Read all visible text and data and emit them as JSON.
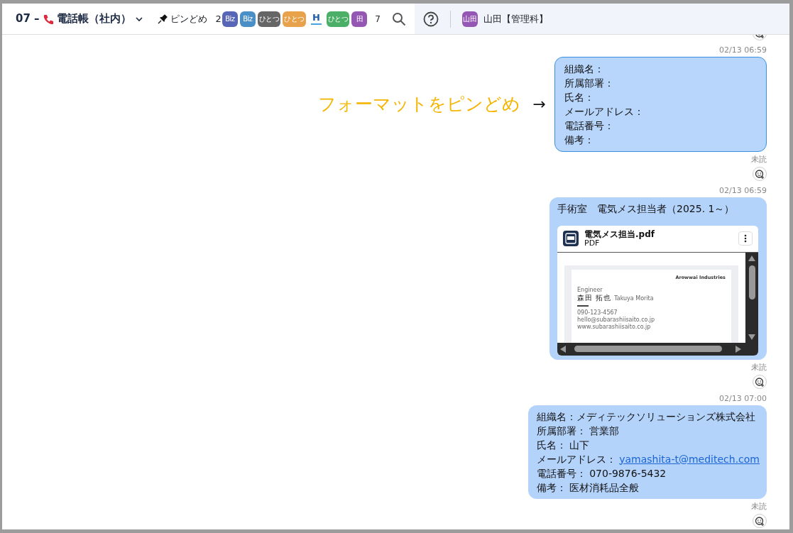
{
  "header": {
    "channel_number": "07 –",
    "channel_name": "電話帳（社内）",
    "pin_label": "ピンどめ",
    "pin_count": "2",
    "members": [
      {
        "kind": "badge",
        "label": "Biz",
        "color": "#5866b8"
      },
      {
        "kind": "badge",
        "label": "Biz",
        "color": "#4a8fc6"
      },
      {
        "kind": "badge",
        "label": "ひとつ",
        "color": "#666666"
      },
      {
        "kind": "badge",
        "label": "ひとつ",
        "color": "#e9a24c"
      },
      {
        "kind": "letter",
        "label": "H",
        "color": "#1f5faa"
      },
      {
        "kind": "badge",
        "label": "ひとつ",
        "color": "#4caf68"
      },
      {
        "kind": "badge",
        "label": "田",
        "color": "#9457b3"
      }
    ],
    "member_count": "7",
    "user_avatar": "山田",
    "user_name": "山田【管理科】"
  },
  "messages": [
    {
      "kind": "text",
      "time": "02/13 06:59",
      "highlighted": true,
      "annotation": "フォーマットをピンどめ",
      "annotation_arrow": "→",
      "status": "未読",
      "lines": [
        {
          "text": "組織名："
        },
        {
          "text": "所属部署："
        },
        {
          "text": "氏名："
        },
        {
          "text": "メールアドレス："
        },
        {
          "text": "電話番号："
        },
        {
          "text": "備考："
        }
      ]
    },
    {
      "kind": "file",
      "time": "02/13 06:59",
      "highlighted": false,
      "status": "未読",
      "caption": "手術室　電気メス担当者（2025. 1～）",
      "file": {
        "name": "電気メス担当.pdf",
        "type": "PDF",
        "preview": {
          "company": "Arowwai Industries",
          "role": "Engineer",
          "name": "森田 拓也",
          "name_latin": "Takuya Morita",
          "phone": "090-123-4567",
          "email": "hello@subarashiisaito.co.jp",
          "web": "www.subarashiisaito.co.jp"
        }
      }
    },
    {
      "kind": "text",
      "time": "02/13 07:00",
      "highlighted": false,
      "status": "未読",
      "lines": [
        {
          "text": "組織名：メディテックソリューションズ株式会社"
        },
        {
          "text": "所属部署： 営業部"
        },
        {
          "text": "氏名： 山下"
        },
        {
          "text": "メールアドレス： ",
          "link": "yamashita-t@meditech.com"
        },
        {
          "text": "電話番号： 070-9876-5432"
        },
        {
          "text": "備考： 医材消耗品全般"
        }
      ]
    }
  ]
}
